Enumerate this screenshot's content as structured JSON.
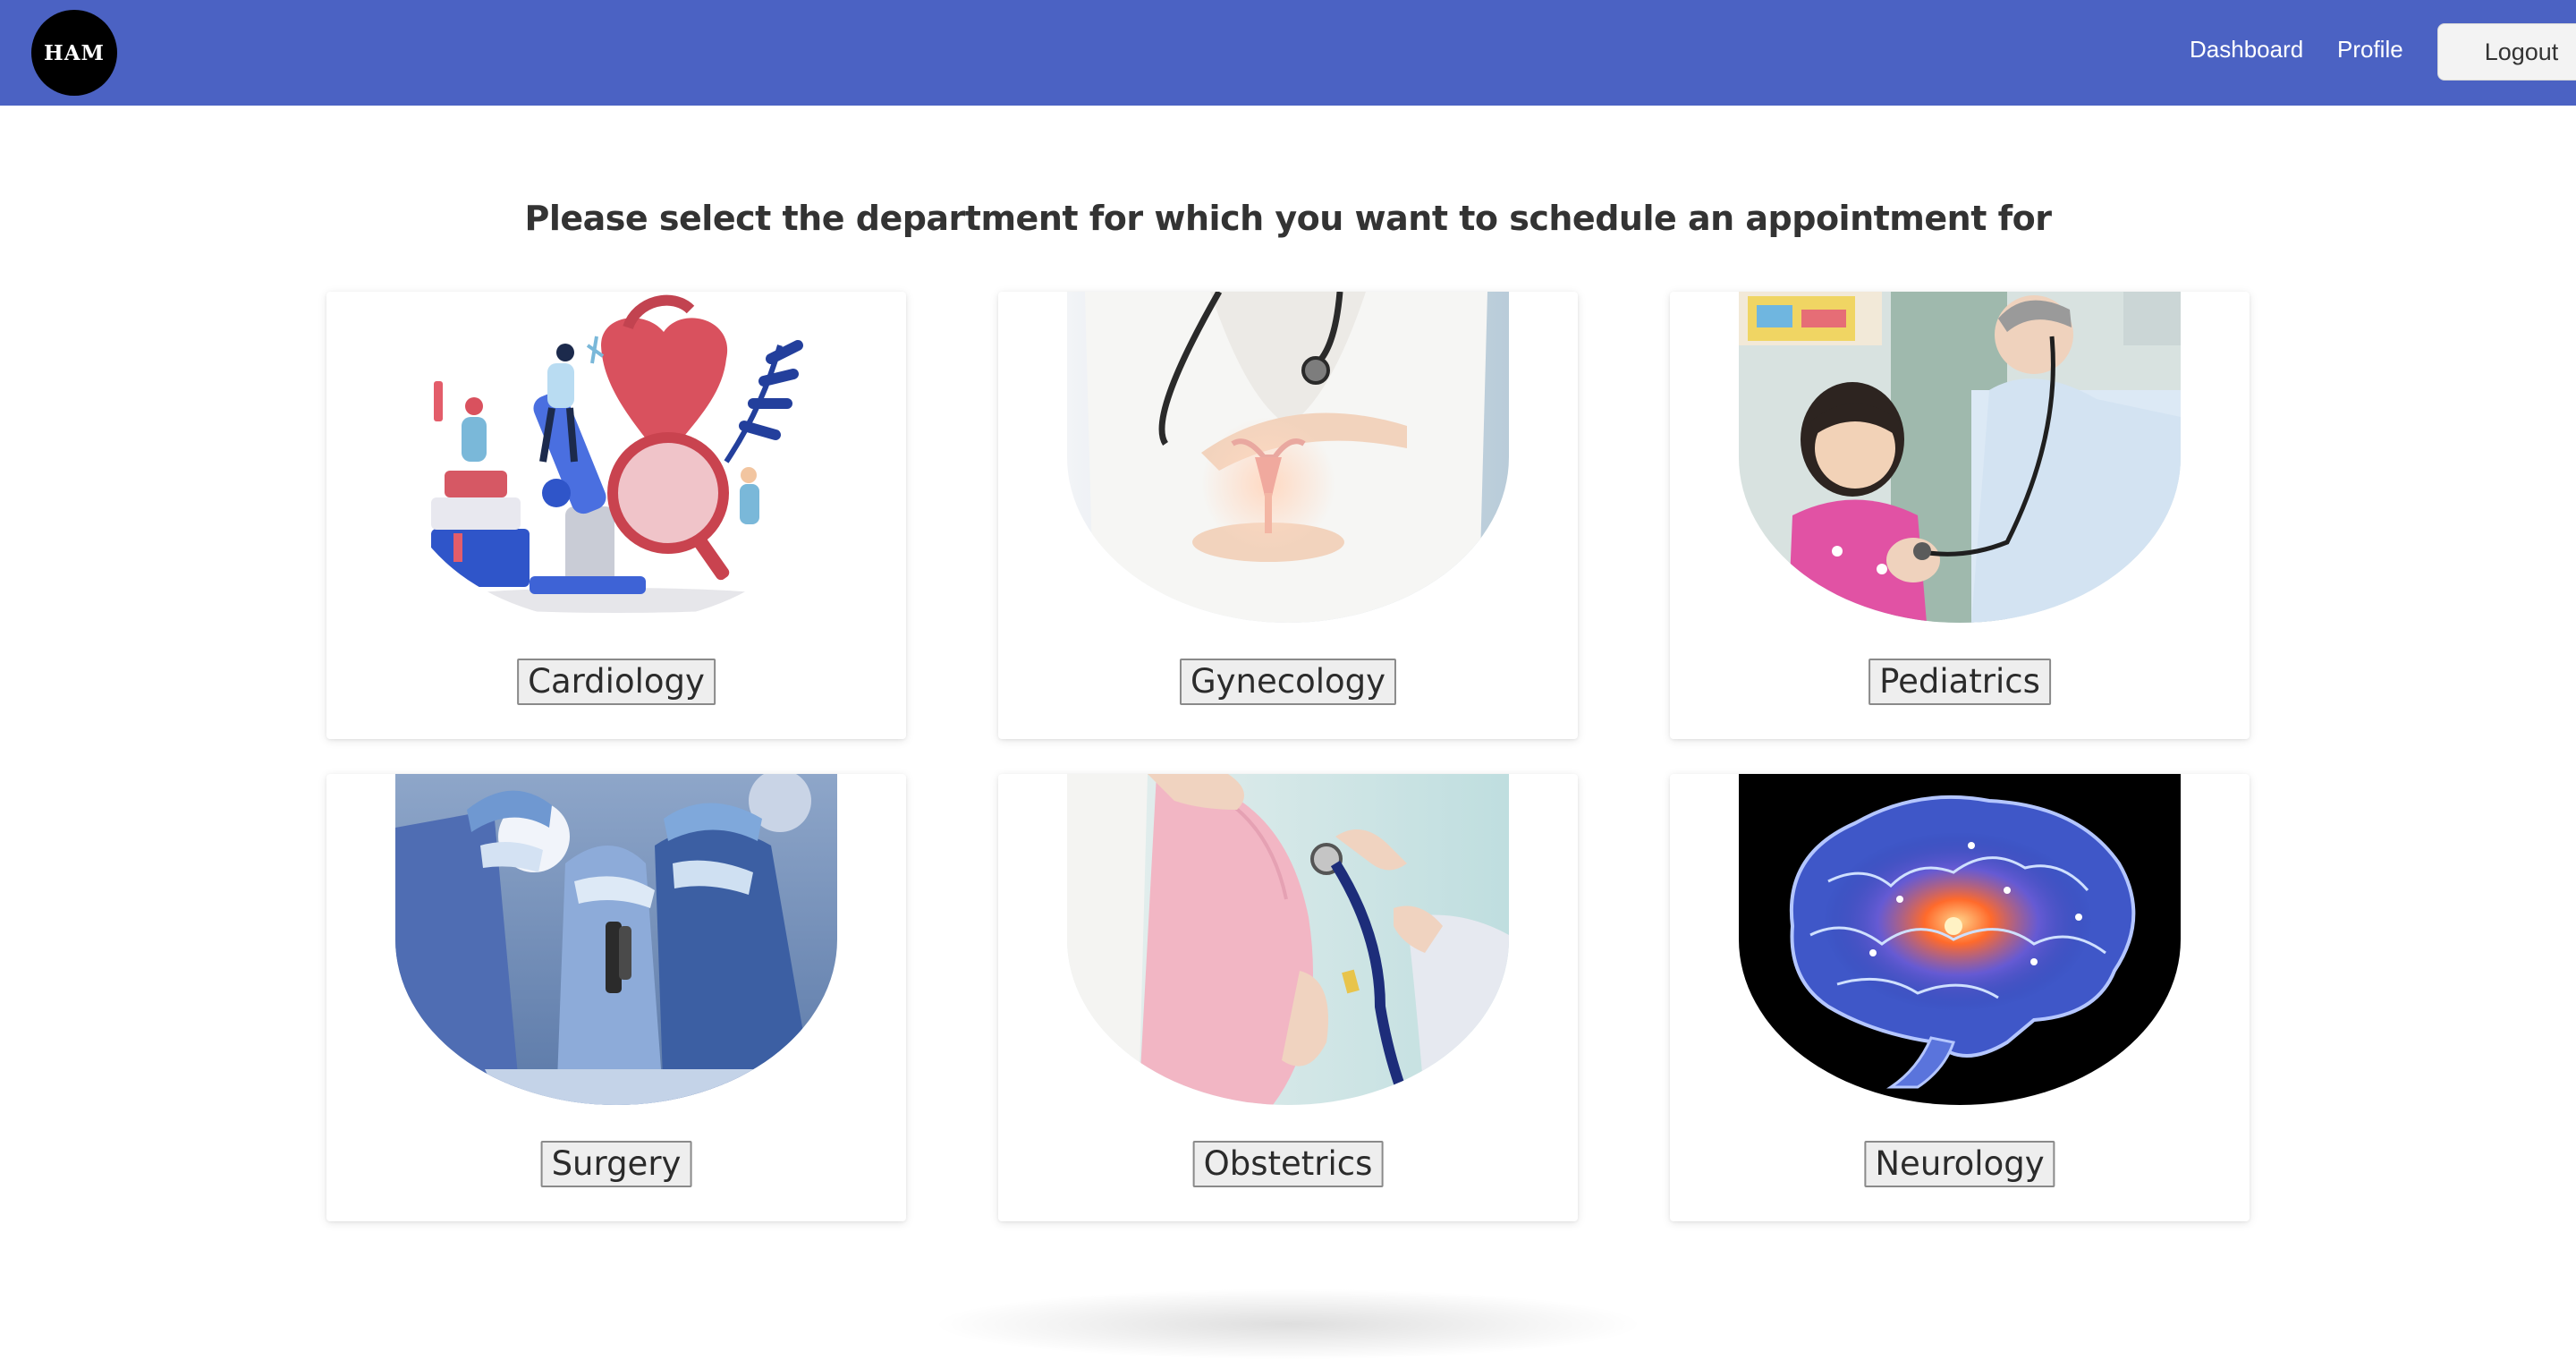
{
  "navbar": {
    "logo_text": "HAM",
    "links": {
      "dashboard": "Dashboard",
      "profile": "Profile"
    },
    "logout_label": "Logout",
    "color": "#4b62c3"
  },
  "main": {
    "heading": "Please select the department for which you want to schedule an appointment for",
    "departments": [
      {
        "label": "Cardiology",
        "image": "heart-microscope-illustration"
      },
      {
        "label": "Gynecology",
        "image": "doctor-holding-uterus-hologram"
      },
      {
        "label": "Pediatrics",
        "image": "doctor-examining-child"
      },
      {
        "label": "Surgery",
        "image": "surgeons-operating"
      },
      {
        "label": "Obstetrics",
        "image": "pregnant-belly-stethoscope"
      },
      {
        "label": "Neurology",
        "image": "glowing-brain"
      }
    ]
  }
}
